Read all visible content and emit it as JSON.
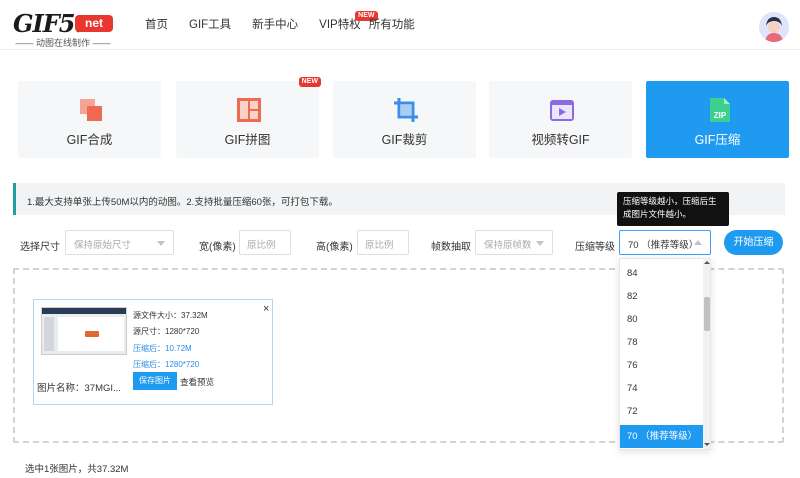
{
  "header": {
    "logo_text": "GIF5.",
    "logo_badge": "net",
    "logo_sub": "—— 动图在线制作 ——",
    "nav": [
      "首页",
      "GIF工具",
      "新手中心",
      "VIP特权",
      "所有功能"
    ],
    "nav_new_badge": "NEW"
  },
  "tools": [
    {
      "label": "GIF合成",
      "icon": "gif-merge-icon"
    },
    {
      "label": "GIF拼图",
      "icon": "gif-collage-icon",
      "badge": "NEW"
    },
    {
      "label": "GIF裁剪",
      "icon": "gif-crop-icon"
    },
    {
      "label": "视频转GIF",
      "icon": "video-to-gif-icon"
    },
    {
      "label": "GIF压缩",
      "icon": "gif-compress-icon",
      "active": true,
      "icon_text": "ZIP"
    }
  ],
  "notice": "1.最大支持单张上传50M以内的动图。2.支持批量压缩60张，可打包下载。",
  "tooltip": "压缩等级越小，压缩后生成图片文件越小。",
  "options": {
    "size_label": "选择尺寸",
    "size_value": "保持原始尺寸",
    "width_label": "宽(像素)",
    "width_placeholder": "原比例",
    "height_label": "高(像素)",
    "height_placeholder": "原比例",
    "frames_label": "帧数抽取",
    "frames_value": "保持原帧数",
    "level_label": "压缩等级",
    "level_value": "70 （推荐等级）",
    "start_button": "开始压缩"
  },
  "file": {
    "close": "×",
    "orig_size": "源文件大小：37.32M",
    "orig_dims": "源尺寸：1280*720",
    "compressed_size": "压缩后：10.72M",
    "compressed_dims": "压缩后：1280*720",
    "name": "图片名称：37MGI...",
    "save_button": "保存图片",
    "preview_link": "查看预览"
  },
  "summary": "选中1张图片，共37.32M",
  "level_options": [
    "84",
    "82",
    "80",
    "78",
    "76",
    "74",
    "72",
    "70 （推荐等级）"
  ],
  "colors": {
    "accent": "#1e9bf0",
    "badge_red": "#e8372f",
    "notice_border": "#20a0a0"
  }
}
